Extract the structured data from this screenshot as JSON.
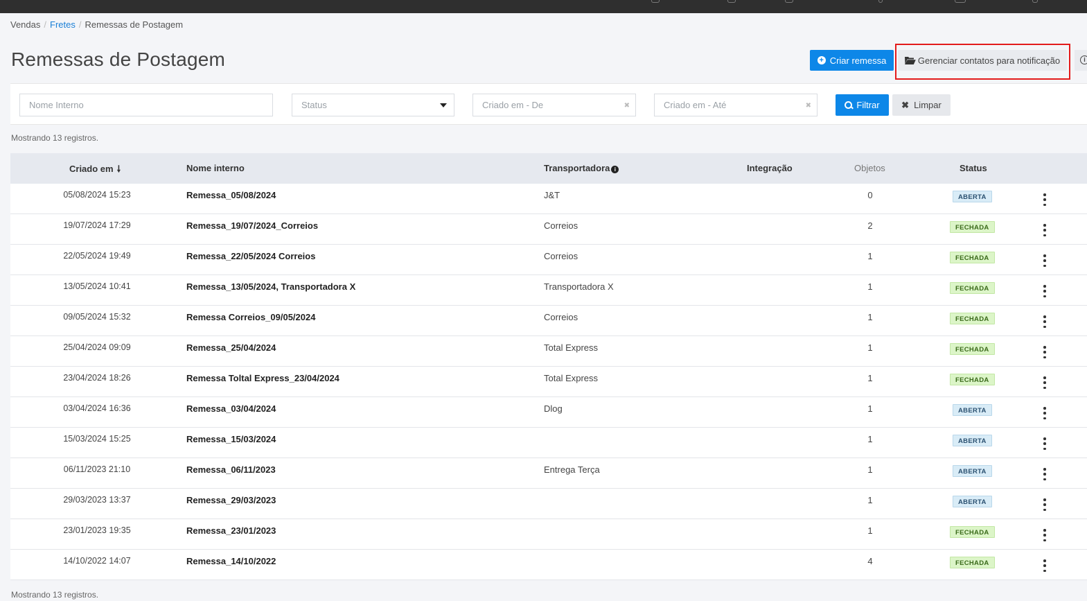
{
  "breadcrumb": {
    "item1": "Vendas",
    "item2": "Fretes",
    "item3": "Remessas de Postagem"
  },
  "page": {
    "title": "Remessas de Postagem"
  },
  "actions": {
    "create_label": "Criar remessa",
    "manage_label": "Gerenciar contatos para notificação"
  },
  "filters": {
    "internal_name_placeholder": "Nome Interno",
    "status_placeholder": "Status",
    "created_from_placeholder": "Criado em - De",
    "created_to_placeholder": "Criado em - Até",
    "filter_label": "Filtrar",
    "clear_label": "Limpar"
  },
  "summary": {
    "count_text": "Mostrando 13 registros."
  },
  "table": {
    "headers": {
      "created": "Criado em",
      "internal_name": "Nome interno",
      "carrier": "Transportadora",
      "integration": "Integração",
      "objects": "Objetos",
      "status": "Status"
    },
    "rows": [
      {
        "created": "05/08/2024 15:23",
        "name": "Remessa_05/08/2024",
        "carrier": "J&T",
        "integration": "",
        "objects": "0",
        "status": "ABERTA"
      },
      {
        "created": "19/07/2024 17:29",
        "name": "Remessa_19/07/2024_Correios",
        "carrier": "Correios",
        "integration": "",
        "objects": "2",
        "status": "FECHADA"
      },
      {
        "created": "22/05/2024 19:49",
        "name": "Remessa_22/05/2024 Correios",
        "carrier": "Correios",
        "integration": "",
        "objects": "1",
        "status": "FECHADA"
      },
      {
        "created": "13/05/2024 10:41",
        "name": "Remessa_13/05/2024, Transportadora X",
        "carrier": "Transportadora X",
        "integration": "",
        "objects": "1",
        "status": "FECHADA"
      },
      {
        "created": "09/05/2024 15:32",
        "name": "Remessa Correios_09/05/2024",
        "carrier": "Correios",
        "integration": "",
        "objects": "1",
        "status": "FECHADA"
      },
      {
        "created": "25/04/2024 09:09",
        "name": "Remessa_25/04/2024",
        "carrier": "Total Express",
        "integration": "",
        "objects": "1",
        "status": "FECHADA"
      },
      {
        "created": "23/04/2024 18:26",
        "name": "Remessa Toltal Express_23/04/2024",
        "carrier": "Total Express",
        "integration": "",
        "objects": "1",
        "status": "FECHADA"
      },
      {
        "created": "03/04/2024 16:36",
        "name": "Remessa_03/04/2024",
        "carrier": "Dlog",
        "integration": "",
        "objects": "1",
        "status": "ABERTA"
      },
      {
        "created": "15/03/2024 15:25",
        "name": "Remessa_15/03/2024",
        "carrier": "",
        "integration": "",
        "objects": "1",
        "status": "ABERTA"
      },
      {
        "created": "06/11/2023 21:10",
        "name": "Remessa_06/11/2023",
        "carrier": "Entrega Terça",
        "integration": "",
        "objects": "1",
        "status": "ABERTA"
      },
      {
        "created": "29/03/2023 13:37",
        "name": "Remessa_29/03/2023",
        "carrier": "",
        "integration": "",
        "objects": "1",
        "status": "ABERTA"
      },
      {
        "created": "23/01/2023 19:35",
        "name": "Remessa_23/01/2023",
        "carrier": "",
        "integration": "",
        "objects": "1",
        "status": "FECHADA"
      },
      {
        "created": "14/10/2022 14:07",
        "name": "Remessa_14/10/2022",
        "carrier": "",
        "integration": "",
        "objects": "4",
        "status": "FECHADA"
      }
    ]
  },
  "icons": {
    "create": "plus-circle-icon",
    "manage": "folder-open-icon",
    "info": "info-icon",
    "filter": "search-icon",
    "clear": "close-icon",
    "sort": "arrow-down-icon",
    "row_menu": "kebab-menu-icon"
  },
  "colors": {
    "primary": "#0d87e8",
    "highlight": "#e31b1b",
    "aberta_bg": "#d9ecf7",
    "fechada_bg": "#dcf5c8"
  }
}
